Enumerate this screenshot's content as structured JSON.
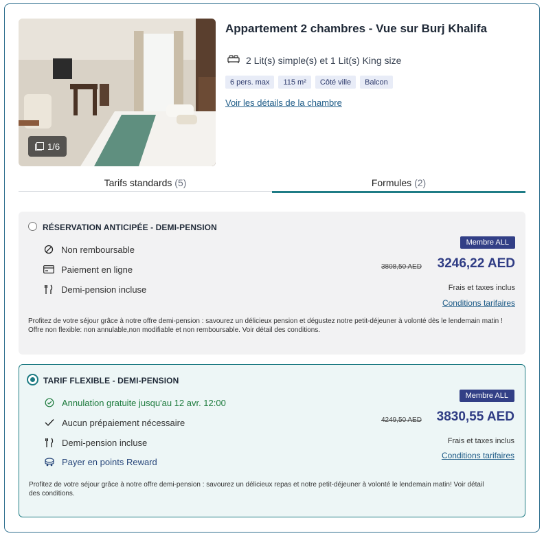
{
  "room": {
    "title": "Appartement 2 chambres - Vue sur Burj Khalifa",
    "beds": "2 Lit(s) simple(s) et 1 Lit(s) King size",
    "tags": [
      "6 pers. max",
      "115 m²",
      "Côté ville",
      "Balcon"
    ],
    "details_link": "Voir les détails de la chambre",
    "photo_counter": "1/6"
  },
  "tabs": [
    {
      "label": "Tarifs standards",
      "count": "(5)"
    },
    {
      "label": "Formules",
      "count": "(2)"
    }
  ],
  "offers": [
    {
      "title": "RÉSERVATION ANTICIPÉE - DEMI-PENSION",
      "features": [
        {
          "icon": "no-entry-icon",
          "label": "Non remboursable"
        },
        {
          "icon": "credit-card-icon",
          "label": "Paiement en ligne"
        },
        {
          "icon": "fork-knife-icon",
          "label": "Demi-pension incluse"
        }
      ],
      "badge": "Membre ALL",
      "old_price": "3808,50 AED",
      "price": "3246,22 AED",
      "tax_note": "Frais et taxes inclus",
      "conditions_link": "Conditions tarifaires",
      "description": "Profitez de votre séjour grâce à notre offre demi-pension : savourez un délicieux pension et dégustez notre petit-déjeuner à volonté dès le lendemain matin ! Offre non flexible: non annulable,non modifiable et non remboursable. Voir détail des conditions.",
      "selected": false
    },
    {
      "title": "TARIF FLEXIBLE - DEMI-PENSION",
      "features": [
        {
          "icon": "clock-check-icon",
          "label": "Annulation gratuite jusqu'au 12 avr. 12:00"
        },
        {
          "icon": "checkmark-icon",
          "label": "Aucun prépaiement nécessaire"
        },
        {
          "icon": "fork-knife-icon",
          "label": "Demi-pension incluse"
        },
        {
          "icon": "reward-points-icon",
          "label": "Payer en points Reward"
        }
      ],
      "badge": "Membre ALL",
      "old_price": "4249,50 AED",
      "price": "3830,55 AED",
      "tax_note": "Frais et taxes inclus",
      "conditions_link": "Conditions tarifaires",
      "description": "Profitez de votre séjour grâce à notre offre demi-pension : savourez un délicieux repas et notre petit-déjeuner à volonté le lendemain matin! Voir détail des conditions.",
      "selected": true
    }
  ],
  "colors": {
    "accent_teal": "#1d7b83",
    "price_blue": "#2f3c84",
    "badge_bg": "#323f86",
    "link_blue": "#1c5a86",
    "green_text": "#1c7a3c"
  }
}
